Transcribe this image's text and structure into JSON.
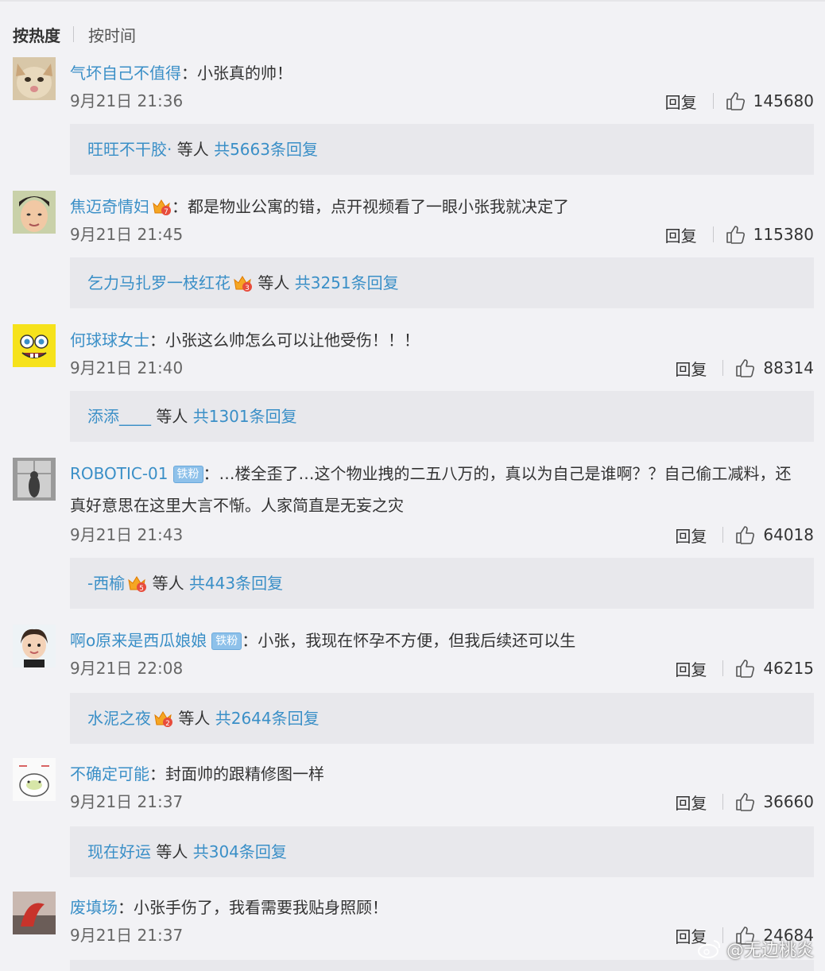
{
  "sort": {
    "hot": "按热度",
    "time": "按时间"
  },
  "comments": [
    {
      "user": "气坏自己不值得",
      "badge": "",
      "crown": "",
      "text": "小张真的帅！",
      "time": "9月21日 21:36",
      "reply_label": "回复",
      "likes": "145680",
      "reply_user": "旺旺不干胶·",
      "reply_crown": "",
      "reply_mid": "等人",
      "reply_total": "共5663条回复"
    },
    {
      "user": "焦迈奇情妇",
      "badge": "",
      "crown": "7",
      "text": "都是物业公寓的错，点开视频看了一眼小张我就决定了",
      "time": "9月21日 21:45",
      "reply_label": "回复",
      "likes": "115380",
      "reply_user": "乞力马扎罗一枝红花",
      "reply_crown": "3",
      "reply_mid": "等人",
      "reply_total": "共3251条回复"
    },
    {
      "user": "何球球女士",
      "badge": "",
      "crown": "",
      "text": "小张这么帅怎么可以让他受伤！！！",
      "time": "9月21日 21:40",
      "reply_label": "回复",
      "likes": "88314",
      "reply_user": "添添____",
      "reply_crown": "",
      "reply_mid": "等人",
      "reply_total": "共1301条回复"
    },
    {
      "user": "ROBOTIC-01",
      "badge": "铁粉",
      "crown": "",
      "text": "…楼全歪了…这个物业拽的二五八万的，真以为自己是谁啊？？自己偷工减料，还真好意思在这里大言不惭。人家简直是无妄之灾",
      "time": "9月21日 21:43",
      "reply_label": "回复",
      "likes": "64018",
      "reply_user": "-西榆",
      "reply_crown": "5",
      "reply_mid": "等人",
      "reply_total": "共443条回复"
    },
    {
      "user": "啊o原来是西瓜娘娘",
      "badge": "铁粉",
      "crown": "",
      "text": "小张，我现在怀孕不方便，但我后续还可以生",
      "time": "9月21日 22:08",
      "reply_label": "回复",
      "likes": "46215",
      "reply_user": "水泥之夜",
      "reply_crown": "2",
      "reply_mid": "等人",
      "reply_total": "共2644条回复"
    },
    {
      "user": "不确定可能",
      "badge": "",
      "crown": "",
      "text": "封面帅的跟精修图一样",
      "time": "9月21日 21:37",
      "reply_label": "回复",
      "likes": "36660",
      "reply_user": "现在好运",
      "reply_crown": "",
      "reply_mid": "等人",
      "reply_total": "共304条回复"
    },
    {
      "user": "废填场",
      "badge": "",
      "crown": "",
      "text": "小张手伤了，我看需要我贴身照顾！",
      "time": "9月21日 21:37",
      "reply_label": "回复",
      "likes": "24684",
      "reply_user": "",
      "reply_crown": "",
      "reply_mid": "",
      "reply_total": ""
    }
  ],
  "watermark": "@无边桃炎",
  "colors": {
    "link": "#3a8fc7",
    "background": "#f2f2f5",
    "reply_box": "#e8e8ec",
    "fan_badge": "#8ec1ea"
  },
  "icons": {
    "like": "thumbs-up-icon",
    "crown": "fan-crown-icon",
    "weibo": "weibo-logo-icon"
  }
}
